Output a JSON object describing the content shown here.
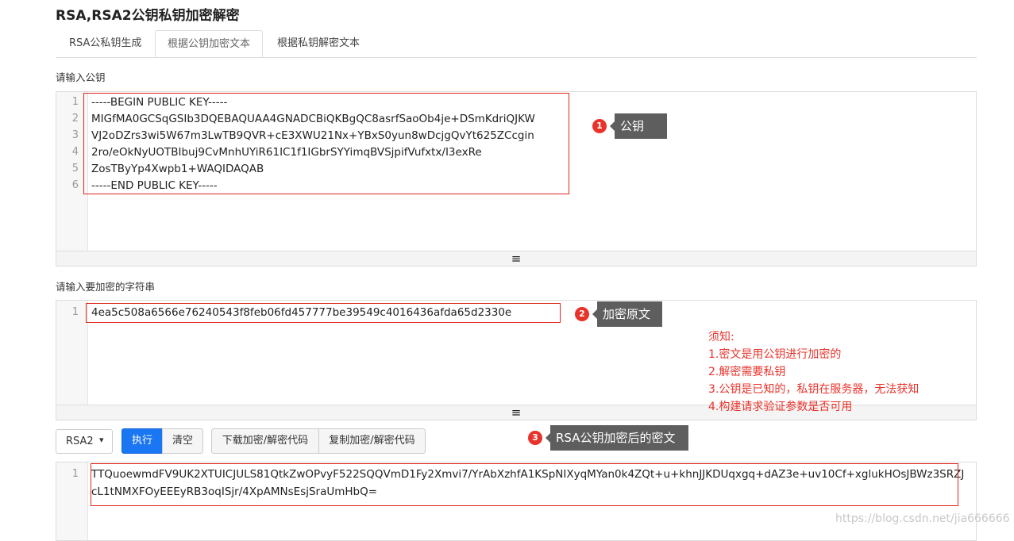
{
  "page": {
    "title": "RSA,RSA2公钥私钥加密解密"
  },
  "tabs": [
    {
      "label": "RSA公私钥生成"
    },
    {
      "label": "根据公钥加密文本"
    },
    {
      "label": "根据私钥解密文本"
    }
  ],
  "public_key": {
    "label": "请输入公钥",
    "lines": [
      {
        "n": "1",
        "text": "-----BEGIN PUBLIC KEY-----"
      },
      {
        "n": "2",
        "text": "MIGfMA0GCSqGSIb3DQEBAQUAA4GNADCBiQKBgQC8asrfSaoOb4je+DSmKdriQJKW"
      },
      {
        "n": "3",
        "text": "VJ2oDZrs3wi5W67m3LwTB9QVR+cE3XWU21Nx+YBxS0yun8wDcjgQvYt625ZCcgin"
      },
      {
        "n": "4",
        "text": "2ro/eOkNyUOTBIbuj9CvMnhUYiR61IC1f1IGbrSYYimqBVSjpifVufxtx/I3exRe"
      },
      {
        "n": "5",
        "text": "ZosTByYp4Xwpb1+WAQIDAQAB"
      },
      {
        "n": "6",
        "text": "-----END PUBLIC KEY-----"
      }
    ]
  },
  "plaintext": {
    "label": "请输入要加密的字符串",
    "lines": [
      {
        "n": "1",
        "text": "4ea5c508a6566e76240543f8feb06fd457777be39549c4016436afda65d2330e"
      }
    ]
  },
  "resize_handle": "≡",
  "annotations": [
    {
      "num": "1",
      "text": "公钥"
    },
    {
      "num": "2",
      "text": "加密原文"
    },
    {
      "num": "3",
      "text": "RSA公钥加密后的密文"
    }
  ],
  "notes": {
    "title": "须知:",
    "items": [
      "1.密文是用公钥进行加密的",
      "2.解密需要私钥",
      "3.公钥是已知的，私钥在服务器，无法获知",
      "4.构建请求验证参数是否可用"
    ]
  },
  "toolbar": {
    "algorithm": "RSA2",
    "execute": "执行",
    "clear": "清空",
    "download": "下载加密/解密代码",
    "copy": "复制加密/解密代码"
  },
  "output": {
    "line_no": "1",
    "lines": [
      "TTQuoewmdFV9UK2XTUICJULS81QtkZwOPvyF522SQQVmD1Fy2Xmvi7/YrAbXzhfA1KSpNIXyqMYan0k4ZQt+u+khnJJKDUqxgq+dAZ3e+uv10Cf+xglukHOsJBWz3SRZJ",
      "cL1tNMXFOyEEEyRB3oqISjr/4XpAMNsEsjSraUmHbQ="
    ]
  },
  "watermark": "https://blog.csdn.net/jia666666",
  "colors": {
    "accent": "#1a76f2",
    "annotation_red": "#e8332b",
    "tag_gray": "#5e5e5e"
  }
}
